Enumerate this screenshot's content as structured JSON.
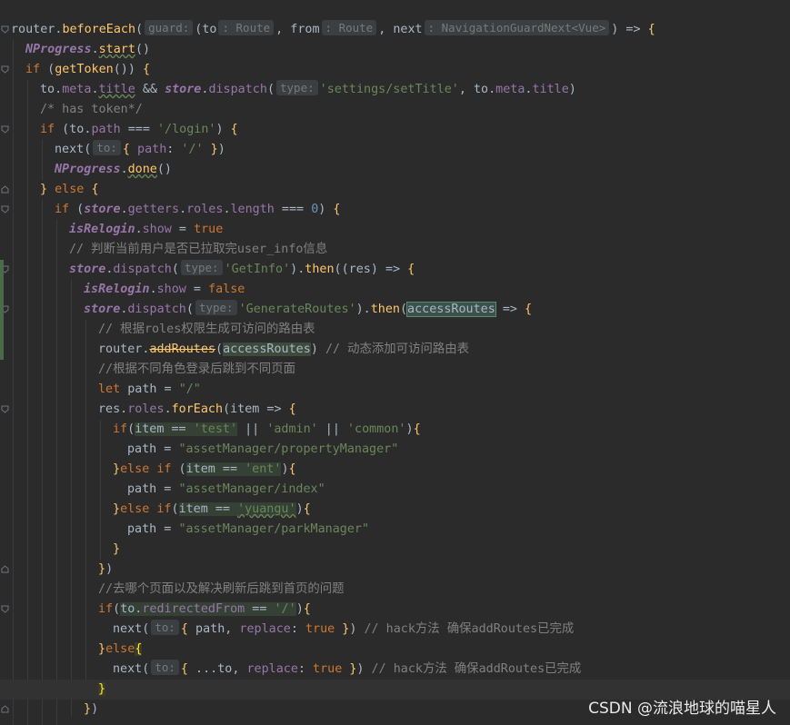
{
  "editor": {
    "line_height": "22px",
    "lines": [
      "router.beforeEach(",
      "NProgress.start()",
      "if (getToken()) {",
      "to.meta.title && store.dispatch(",
      "/* has token*/",
      "if (to.path === '/login') {",
      "next(",
      "NProgress.done()",
      "} else {",
      "if (store.getters.roles.length === 0) {",
      "isRelogin.show = true",
      "// 判断当前用户是否已拉取完user_info信息",
      "store.dispatch(",
      "isRelogin.show = false",
      "store.dispatch(",
      "// 根据roles权限生成可访问的路由表",
      "router.addRoutes(accessRoutes) // 动态添加可访问路由表",
      "//根据不同角色登录后跳到不同页面",
      "let path = \"/\"",
      "res.roles.forEach(item => {",
      "if(item == 'test' || 'admin' || 'common'){",
      "path = \"assetManager/propertyManager\"",
      "}else if (item == 'ent'){",
      "path = \"assetManager/index\"",
      "}else if(item == 'yuangu'){",
      "path = \"assetManager/parkManager\"",
      "}",
      "})",
      "//去哪个页面以及解决刷新后跳到首页的问题",
      "if(to.redirectedFrom == '/'){",
      "next(",
      "}else{",
      "next(",
      "}",
      "})"
    ],
    "hints": {
      "guard": "guard:",
      "to_type": ": Route",
      "from_type": ": Route",
      "next_type": ": NavigationGuardNext<Vue>",
      "type": "type:",
      "to": "to:"
    }
  },
  "watermark": "CSDN @流浪地球的喵星人",
  "colors": {
    "background": "#2b2b2b",
    "keyword": "#cc7832",
    "function": "#ffc66d",
    "property": "#9876aa",
    "string": "#6a8759",
    "number": "#6897bb",
    "comment": "#808080",
    "text": "#a9b7c6"
  }
}
